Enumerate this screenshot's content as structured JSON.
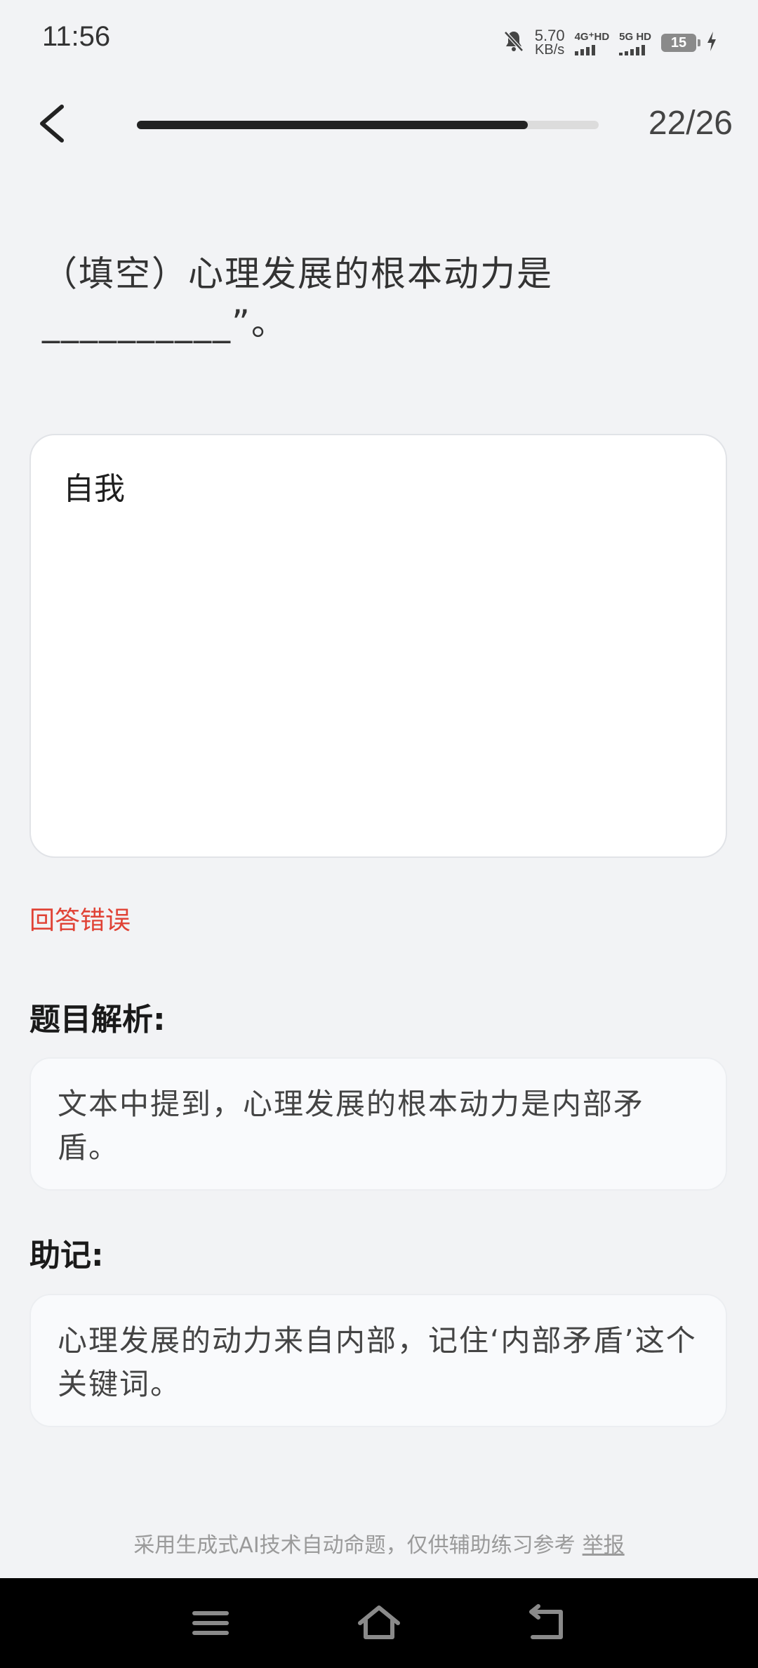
{
  "status_bar": {
    "time": "11:56",
    "net_speed_value": "5.70",
    "net_speed_unit": "KB/s",
    "sim1_label": "4G⁺HD",
    "sim2_label": "5G HD",
    "battery": "15"
  },
  "header": {
    "progress_text": "22/26",
    "progress_fraction": 0.846
  },
  "question": {
    "text": "（填空）心理发展的根本动力是__________”。"
  },
  "answer": {
    "text": "自我"
  },
  "result": {
    "text": "回答错误",
    "color": "#e04235"
  },
  "analysis": {
    "title": "题目解析:",
    "text": "文本中提到，心理发展的根本动力是内部矛盾。"
  },
  "mnemonic": {
    "title": "助记:",
    "text": "心理发展的动力来自内部，记住‘内部矛盾’这个关键词。"
  },
  "footer": {
    "note": "采用生成式AI技术自动命题，仅供辅助练习参考",
    "report_label": "举报"
  }
}
